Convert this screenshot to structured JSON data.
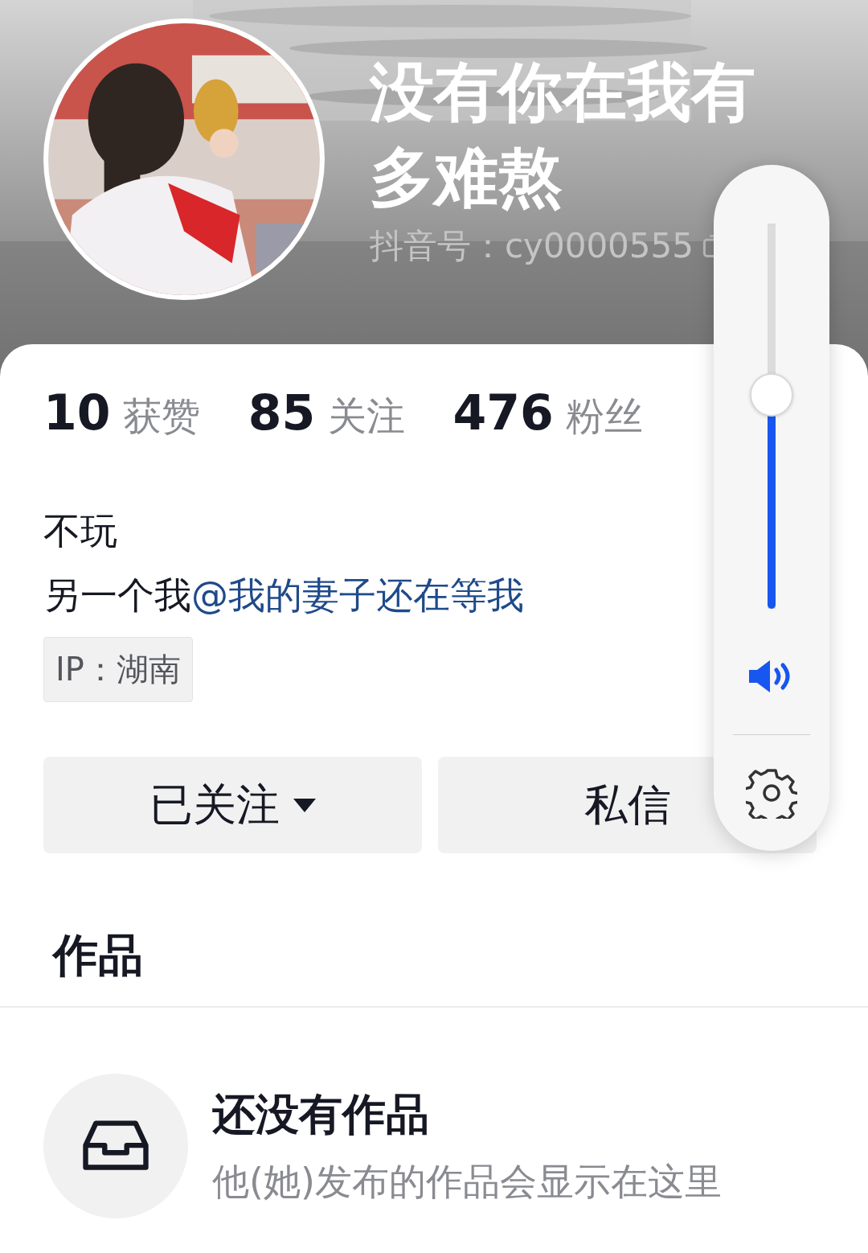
{
  "header": {
    "name_lines": [
      "没有你在我有",
      "多难熬"
    ],
    "account_id": "抖音号：cy0000555"
  },
  "stats": [
    "**10** 获赞",
    "**85** 关注",
    "**476** 粉丝"
  ],
  "bio": [
    {
      "text": "不玩"
    },
    {
      "text": "另一个我",
      "mention": "@我的妻子还在等我"
    }
  ],
  "ip_tag": "IP：湖南",
  "buttons": [
    {
      "kind": "follow",
      "label": "已关注"
    },
    {
      "kind": "message",
      "label": "私信"
    }
  ],
  "tabs": [
    {
      "label": "作品",
      "selected": true
    }
  ],
  "empty_state": {
    "title": "还没有作品",
    "subtitle": "他(她)发布的作品会显示在这里"
  },
  "volume_panel": {
    "level": 0.56
  }
}
